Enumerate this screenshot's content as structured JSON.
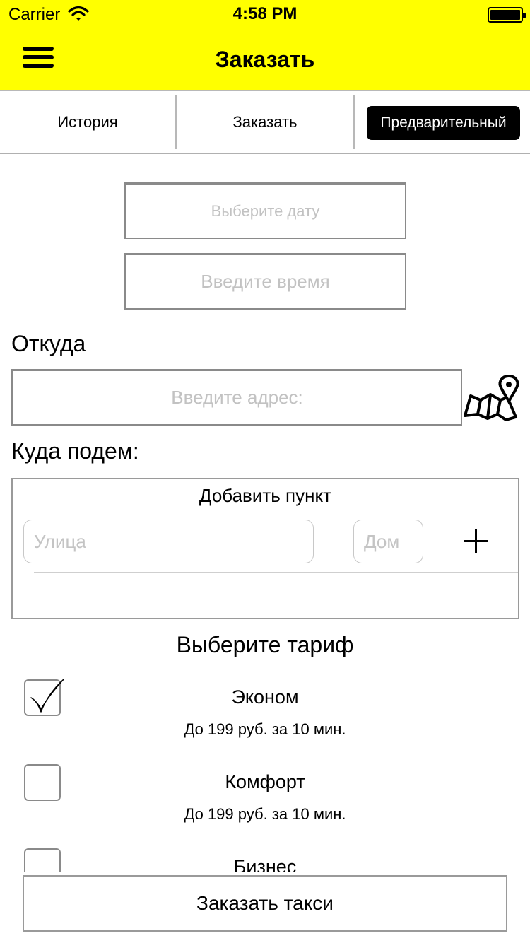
{
  "status_bar": {
    "carrier": "Carrier",
    "time": "4:58 PM"
  },
  "nav": {
    "title": "Заказать"
  },
  "tabs": [
    {
      "label": "История"
    },
    {
      "label": "Заказать"
    },
    {
      "label": "Предварительный",
      "active": true
    }
  ],
  "form": {
    "date_placeholder": "Выберите дату",
    "time_placeholder": "Введите время",
    "from_label": "Откуда",
    "address_placeholder": "Введите адрес:",
    "to_label": "Куда подем:"
  },
  "destination": {
    "title": "Добавить пункт",
    "street_placeholder": "Улица",
    "house_placeholder": "Дом"
  },
  "tariffs": {
    "heading": "Выберите тариф",
    "items": [
      {
        "name": "Эконом",
        "price": "До 199 руб. за 10 мин.",
        "checked": true
      },
      {
        "name": "Комфорт",
        "price": "До 199 руб. за 10 мин.",
        "checked": false
      },
      {
        "name": "Бизнес",
        "checked": false
      }
    ]
  },
  "order_button": "Заказать такси",
  "colors": {
    "nav_background": "#ffff00",
    "active_tab_background": "#000000",
    "placeholder_text": "#c2c2c2"
  },
  "icons": [
    "menu-icon",
    "wifi-icon",
    "battery-icon",
    "map-pin-icon",
    "plus-icon",
    "checkmark-icon"
  ]
}
